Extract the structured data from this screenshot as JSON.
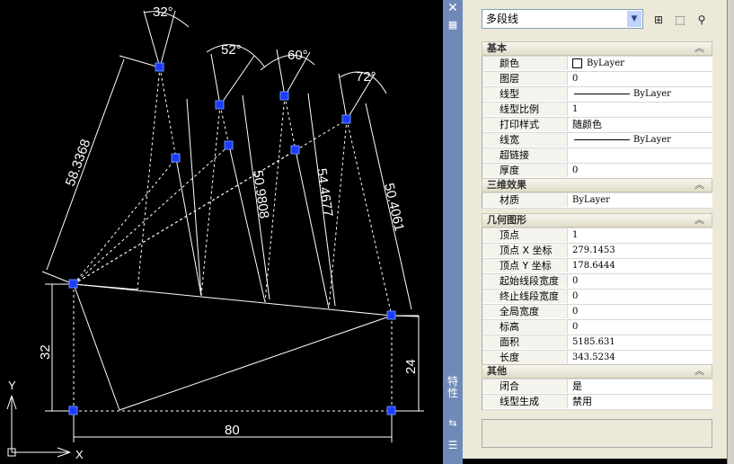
{
  "drawing": {
    "angles": [
      "32°",
      "52°",
      "60°",
      "72°"
    ],
    "lengths": [
      "58.3368",
      "50.9808",
      "54.4677",
      "50.4061"
    ],
    "dims": {
      "left": "32",
      "right": "24",
      "bottom": "80"
    },
    "axes": {
      "x": "X",
      "y": "Y"
    }
  },
  "strip": {
    "close": "✕",
    "title": "特性",
    "colors": {
      "bg": "#6f89b9"
    }
  },
  "panel": {
    "object_type": "多段线",
    "sections": {
      "basic": {
        "title": "基本",
        "rows": [
          {
            "label": "颜色",
            "value": "ByLayer"
          },
          {
            "label": "图层",
            "value": "0"
          },
          {
            "label": "线型",
            "value": "ByLayer"
          },
          {
            "label": "线型比例",
            "value": "1"
          },
          {
            "label": "打印样式",
            "value": "随颜色"
          },
          {
            "label": "线宽",
            "value": "ByLayer"
          },
          {
            "label": "超链接",
            "value": ""
          },
          {
            "label": "厚度",
            "value": "0"
          }
        ]
      },
      "three_d": {
        "title": "三维效果",
        "rows": [
          {
            "label": "材质",
            "value": "ByLayer"
          }
        ]
      },
      "geometry": {
        "title": "几何图形",
        "rows": [
          {
            "label": "顶点",
            "value": "1"
          },
          {
            "label": "顶点 X 坐标",
            "value": "279.1453"
          },
          {
            "label": "顶点 Y 坐标",
            "value": "178.6444"
          },
          {
            "label": "起始线段宽度",
            "value": "0"
          },
          {
            "label": "终止线段宽度",
            "value": "0"
          },
          {
            "label": "全局宽度",
            "value": "0"
          },
          {
            "label": "标高",
            "value": "0"
          },
          {
            "label": "面积",
            "value": "5185.631"
          },
          {
            "label": "长度",
            "value": "343.5234"
          }
        ]
      },
      "misc": {
        "title": "其他",
        "rows": [
          {
            "label": "闭合",
            "value": "是"
          },
          {
            "label": "线型生成",
            "value": "禁用"
          }
        ]
      }
    },
    "collapse_glyph": "︽",
    "dropdown_glyph": "▼"
  }
}
